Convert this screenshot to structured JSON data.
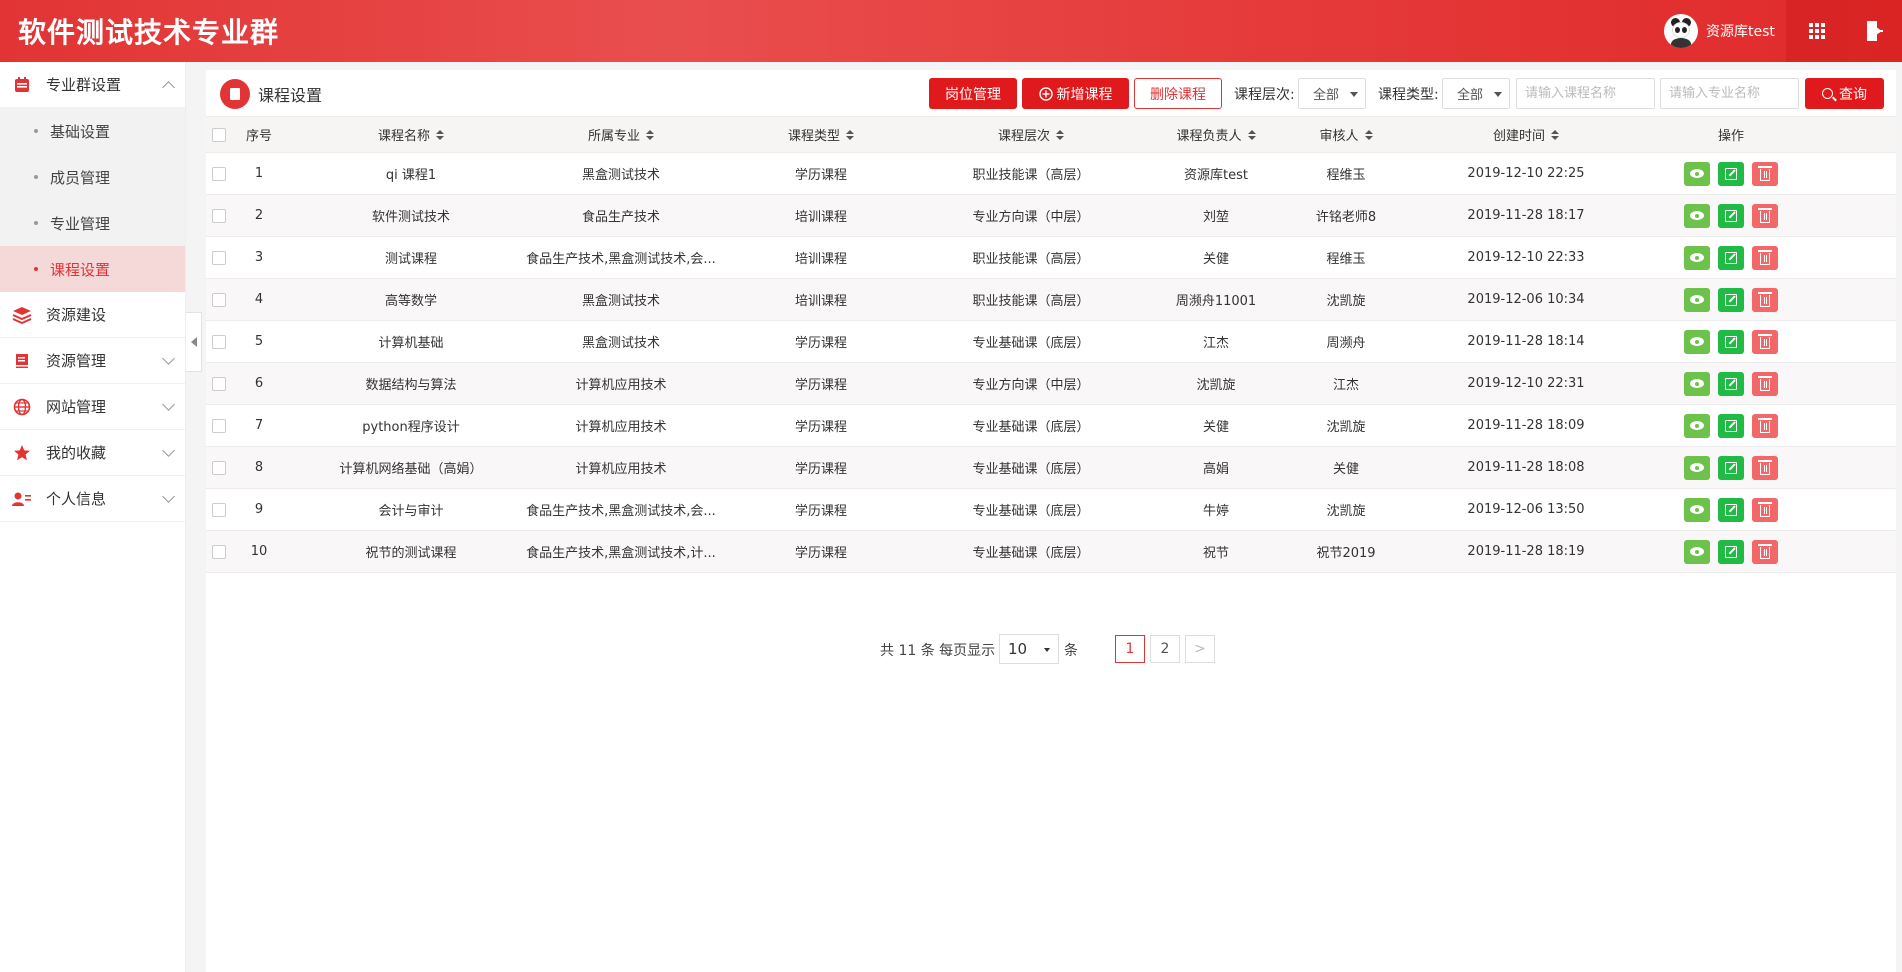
{
  "app": {
    "title": "软件测试技术专业群"
  },
  "user": {
    "name": "资源库test"
  },
  "sidebar": {
    "groups": [
      {
        "label": "专业群设置",
        "icon": "calendar-icon",
        "expanded": true,
        "items": [
          {
            "label": "基础设置"
          },
          {
            "label": "成员管理"
          },
          {
            "label": "专业管理"
          },
          {
            "label": "课程设置",
            "active": true
          }
        ]
      },
      {
        "label": "资源建设",
        "icon": "layers-icon"
      },
      {
        "label": "资源管理",
        "icon": "book-icon"
      },
      {
        "label": "网站管理",
        "icon": "globe-icon"
      },
      {
        "label": "我的收藏",
        "icon": "star-icon"
      },
      {
        "label": "个人信息",
        "icon": "user-card-icon"
      }
    ]
  },
  "panel": {
    "title": "课程设置"
  },
  "toolbar": {
    "post_mgmt": "岗位管理",
    "add_course": "新增课程",
    "delete_course": "删除课程",
    "level_label": "课程层次:",
    "level_value": "全部",
    "type_label": "课程类型:",
    "type_value": "全部",
    "course_placeholder": "请输入课程名称",
    "major_placeholder": "请输入专业名称",
    "search": "查询"
  },
  "table": {
    "headers": [
      "序号",
      "课程名称",
      "所属专业",
      "课程类型",
      "课程层次",
      "课程负责人",
      "审核人",
      "创建时间",
      "操作"
    ],
    "rows": [
      [
        "1",
        "qi 课程1",
        "黑盒测试技术",
        "学历课程",
        "职业技能课（高层）",
        "资源库test",
        "程维玉",
        "2019-12-10 22:25"
      ],
      [
        "2",
        "软件测试技术",
        "食品生产技术",
        "培训课程",
        "专业方向课（中层）",
        "刘堃",
        "许铭老师8",
        "2019-11-28 18:17"
      ],
      [
        "3",
        "测试课程",
        "食品生产技术,黑盒测试技术,会...",
        "培训课程",
        "职业技能课（高层）",
        "关健",
        "程维玉",
        "2019-12-10 22:33"
      ],
      [
        "4",
        "高等数学",
        "黑盒测试技术",
        "培训课程",
        "职业技能课（高层）",
        "周濒舟11001",
        "沈凯旋",
        "2019-12-06 10:34"
      ],
      [
        "5",
        "计算机基础",
        "黑盒测试技术",
        "学历课程",
        "专业基础课（底层）",
        "江杰",
        "周濒舟",
        "2019-11-28 18:14"
      ],
      [
        "6",
        "数据结构与算法",
        "计算机应用技术",
        "学历课程",
        "专业方向课（中层）",
        "沈凯旋",
        "江杰",
        "2019-12-10 22:31"
      ],
      [
        "7",
        "python程序设计",
        "计算机应用技术",
        "学历课程",
        "专业基础课（底层）",
        "关健",
        "沈凯旋",
        "2019-11-28 18:09"
      ],
      [
        "8",
        "计算机网络基础（高娟）",
        "计算机应用技术",
        "学历课程",
        "专业基础课（底层）",
        "高娟",
        "关健",
        "2019-11-28 18:08"
      ],
      [
        "9",
        "会计与审计",
        "食品生产技术,黑盒测试技术,会...",
        "学历课程",
        "专业基础课（底层）",
        "牛婷",
        "沈凯旋",
        "2019-12-06 13:50"
      ],
      [
        "10",
        "祝节的测试课程",
        "食品生产技术,黑盒测试技术,计...",
        "学历课程",
        "专业基础课（底层）",
        "祝节",
        "祝节2019",
        "2019-11-28 18:19"
      ]
    ]
  },
  "pager": {
    "total_prefix": "共 11 条 每页显示",
    "page_size": "10",
    "suffix": "条",
    "pages": [
      "1",
      "2"
    ],
    "current": "1",
    "next": ">"
  },
  "colors": {
    "accent": "#e23434",
    "view": "#6cc24a",
    "edit": "#21ba45",
    "delete": "#f26767"
  }
}
